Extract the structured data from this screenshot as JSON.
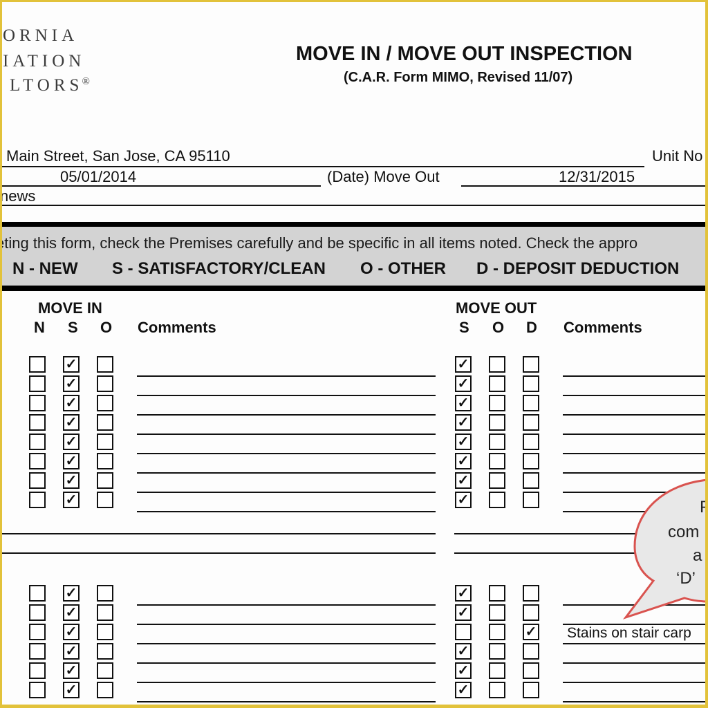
{
  "logo": {
    "lines": [
      "ORNIA",
      "IATION",
      "LTORS"
    ],
    "registered_mark": "®"
  },
  "header": {
    "title": "MOVE IN / MOVE OUT INSPECTION",
    "subtitle": "(C.A.R. Form MIMO, Revised 11/07)"
  },
  "fields": {
    "address_value": "Main Street, San Jose, CA 95110",
    "unit_label": "Unit No",
    "move_in_date_value": "05/01/2014",
    "move_out_label": "(Date) Move Out",
    "move_out_date_value": "12/31/2015",
    "tenant_partial": "news"
  },
  "instructions": {
    "text": "eting this form, check the Premises carefully and be specific in all items noted. Check the appro",
    "legend": [
      {
        "code": "N - NEW"
      },
      {
        "code": "S - SATISFACTORY/CLEAN"
      },
      {
        "code": "O - OTHER"
      },
      {
        "code": "D - DEPOSIT DEDUCTION"
      }
    ]
  },
  "move_in": {
    "heading": "MOVE IN",
    "columns": [
      "N",
      "S",
      "O"
    ],
    "comments_label": "Comments"
  },
  "move_out": {
    "heading": "MOVE OUT",
    "columns": [
      "S",
      "O",
      "D"
    ],
    "comments_label": "Comments"
  },
  "section1_rows": [
    {
      "in": [
        false,
        true,
        false
      ],
      "out": [
        true,
        false,
        false
      ],
      "comment": ""
    },
    {
      "in": [
        false,
        true,
        false
      ],
      "out": [
        true,
        false,
        false
      ],
      "comment": ""
    },
    {
      "in": [
        false,
        true,
        false
      ],
      "out": [
        true,
        false,
        false
      ],
      "comment": ""
    },
    {
      "in": [
        false,
        true,
        false
      ],
      "out": [
        true,
        false,
        false
      ],
      "comment": ""
    },
    {
      "in": [
        false,
        true,
        false
      ],
      "out": [
        true,
        false,
        false
      ],
      "comment": ""
    },
    {
      "in": [
        false,
        true,
        false
      ],
      "out": [
        true,
        false,
        false
      ],
      "comment": ""
    },
    {
      "in": [
        false,
        true,
        false
      ],
      "out": [
        true,
        false,
        false
      ],
      "comment": ""
    },
    {
      "in": [
        false,
        true,
        false
      ],
      "out": [
        true,
        false,
        false
      ],
      "comment": ""
    }
  ],
  "section2_rows": [
    {
      "in": [
        false,
        true,
        false
      ],
      "out": [
        true,
        false,
        false
      ],
      "comment": ""
    },
    {
      "in": [
        false,
        true,
        false
      ],
      "out": [
        true,
        false,
        false
      ],
      "comment": ""
    },
    {
      "in": [
        false,
        true,
        false
      ],
      "out": [
        false,
        false,
        true
      ],
      "comment": "Stains on stair carp"
    },
    {
      "in": [
        false,
        true,
        false
      ],
      "out": [
        true,
        false,
        false
      ],
      "comment": ""
    },
    {
      "in": [
        false,
        true,
        false
      ],
      "out": [
        true,
        false,
        false
      ],
      "comment": ""
    },
    {
      "in": [
        false,
        true,
        false
      ],
      "out": [
        true,
        false,
        false
      ],
      "comment": ""
    }
  ],
  "check_glyph": "✓",
  "callout": {
    "lines": [
      "P",
      "com",
      "a",
      "‘D’"
    ],
    "fill": "#e8e8e8",
    "stroke": "#d9534f"
  },
  "colors": {
    "frame": "#e2c23a",
    "band": "#d3d3d3"
  }
}
